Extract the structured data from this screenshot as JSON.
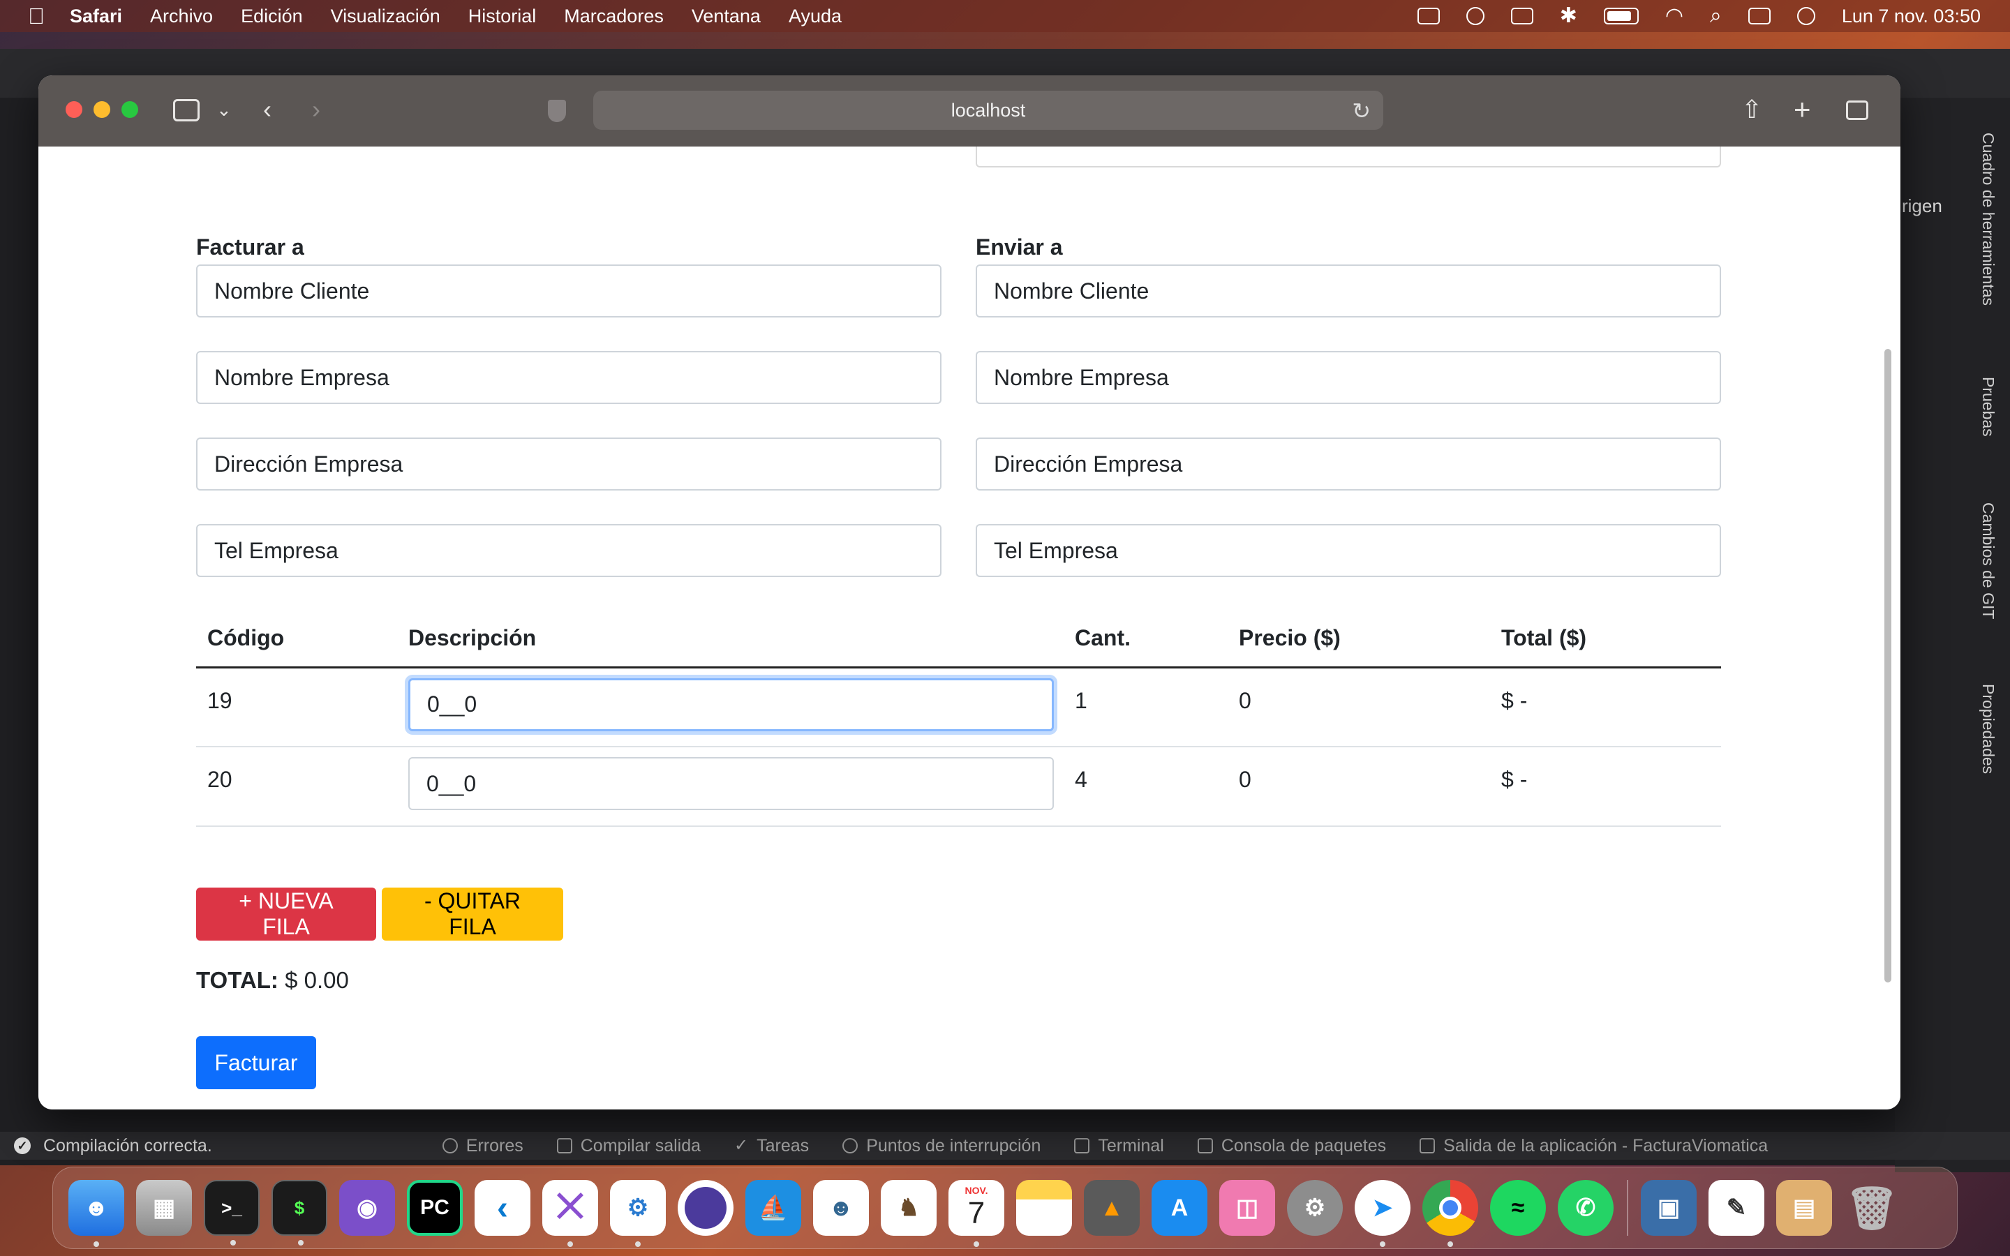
{
  "menubar": {
    "app": "Safari",
    "items": [
      "Archivo",
      "Edición",
      "Visualización",
      "Historial",
      "Marcadores",
      "Ventana",
      "Ayuda"
    ],
    "clock": "Lun 7 nov.  03:50"
  },
  "ide": {
    "vertical_tabs": [
      "Cuadro de herramientas",
      "Pruebas",
      "Cambios de GIT",
      "Propiedades"
    ],
    "branch_label": "rigen",
    "status": {
      "build": "Compilación correcta.",
      "tabs": [
        "Errores",
        "Compilar salida",
        "Tareas",
        "Puntos de interrupción",
        "Terminal",
        "Consola de paquetes",
        "Salida de la aplicación - FacturaViomatica"
      ]
    }
  },
  "safari": {
    "url": "localhost"
  },
  "form": {
    "bill_to": {
      "label": "Facturar a",
      "client": "Nombre Cliente",
      "company": "Nombre Empresa",
      "address": "Dirección Empresa",
      "phone": "Tel Empresa"
    },
    "ship_to": {
      "label": "Enviar a",
      "client": "Nombre Cliente",
      "company": "Nombre Empresa",
      "address": "Dirección Empresa",
      "phone": "Tel Empresa"
    }
  },
  "table": {
    "headers": [
      "Código",
      "Descripción",
      "Cant.",
      "Precio ($)",
      "Total ($)"
    ],
    "rows": [
      {
        "code": "19",
        "description": "0__0",
        "qty": "1",
        "price": "0",
        "total": "$ -"
      },
      {
        "code": "20",
        "description": "0__0",
        "qty": "4",
        "price": "0",
        "total": "$ -"
      }
    ]
  },
  "actions": {
    "add_row": "+ NUEVA FILA",
    "remove_row": "- QUITAR FILA",
    "total_label": "TOTAL:",
    "total_value": "$ 0.00",
    "submit": "Facturar"
  },
  "colors": {
    "primary": "#0d6efd",
    "danger": "#dc3545",
    "warning": "#ffc107"
  },
  "dock": {
    "calendar_month": "NOV.",
    "calendar_day": "7"
  }
}
